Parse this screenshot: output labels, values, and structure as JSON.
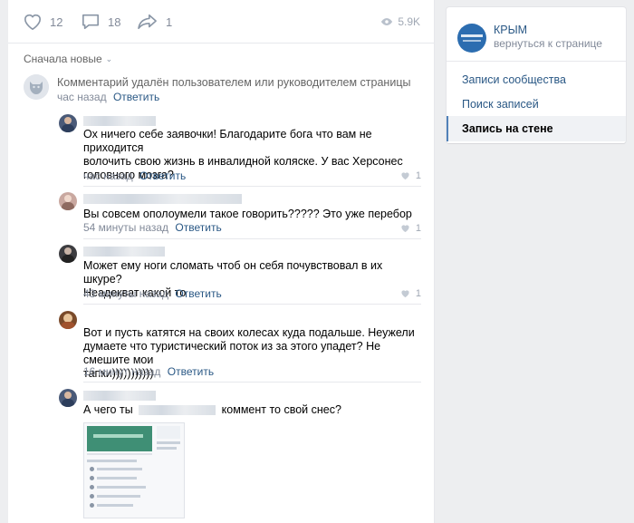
{
  "post_actions": {
    "likes": "12",
    "comments": "18",
    "shares": "1",
    "views": "5.9K"
  },
  "comments_sort": {
    "label": "Сначала новые"
  },
  "deleted_comment": {
    "text": "Комментарий удалён пользователем или руководителем страницы",
    "time": "час назад",
    "reply": "Ответить"
  },
  "comments": [
    {
      "lines": [
        "Ох ничего себе заявочки! Благодарите бога что вам не приходится",
        "волочить свою жизнь в инвалидной коляске. У вас Херсонес",
        "головного мозга?"
      ],
      "time": "час назад",
      "reply": "Ответить",
      "likes": "1"
    },
    {
      "lines": [
        "Вы совсем ополоумели такое говорить????? Это уже перебор"
      ],
      "time": "54 минуты назад",
      "reply": "Ответить",
      "likes": "1"
    },
    {
      "lines": [
        "Может ему ноги сломать чтоб он себя почувствовал в их шкуре?",
        "Неадекват какой то"
      ],
      "time": "43 минуты назад",
      "reply": "Ответить",
      "likes": "1"
    },
    {
      "lines": [
        "Вот и пусть катятся на своих колесах куда подальше. Неужели",
        "думаете что туристический поток из за этого упадет? Не смешите мои",
        "тапки)))))))))))"
      ],
      "time": "16 минут назад",
      "reply": "Ответить",
      "likes": ""
    },
    {
      "text_before": "А чего ты",
      "text_after": "коммент то свой снес?",
      "time": "",
      "reply": ""
    }
  ],
  "sidebar": {
    "community_name": "КРЫМ",
    "back_link": "вернуться к странице",
    "menu": [
      {
        "label": "Записи сообщества"
      },
      {
        "label": "Поиск записей"
      },
      {
        "label": "Запись на стене"
      }
    ]
  },
  "colors": {
    "link": "#2a5885",
    "accent": "#5181b8",
    "meta": "#828a99"
  }
}
